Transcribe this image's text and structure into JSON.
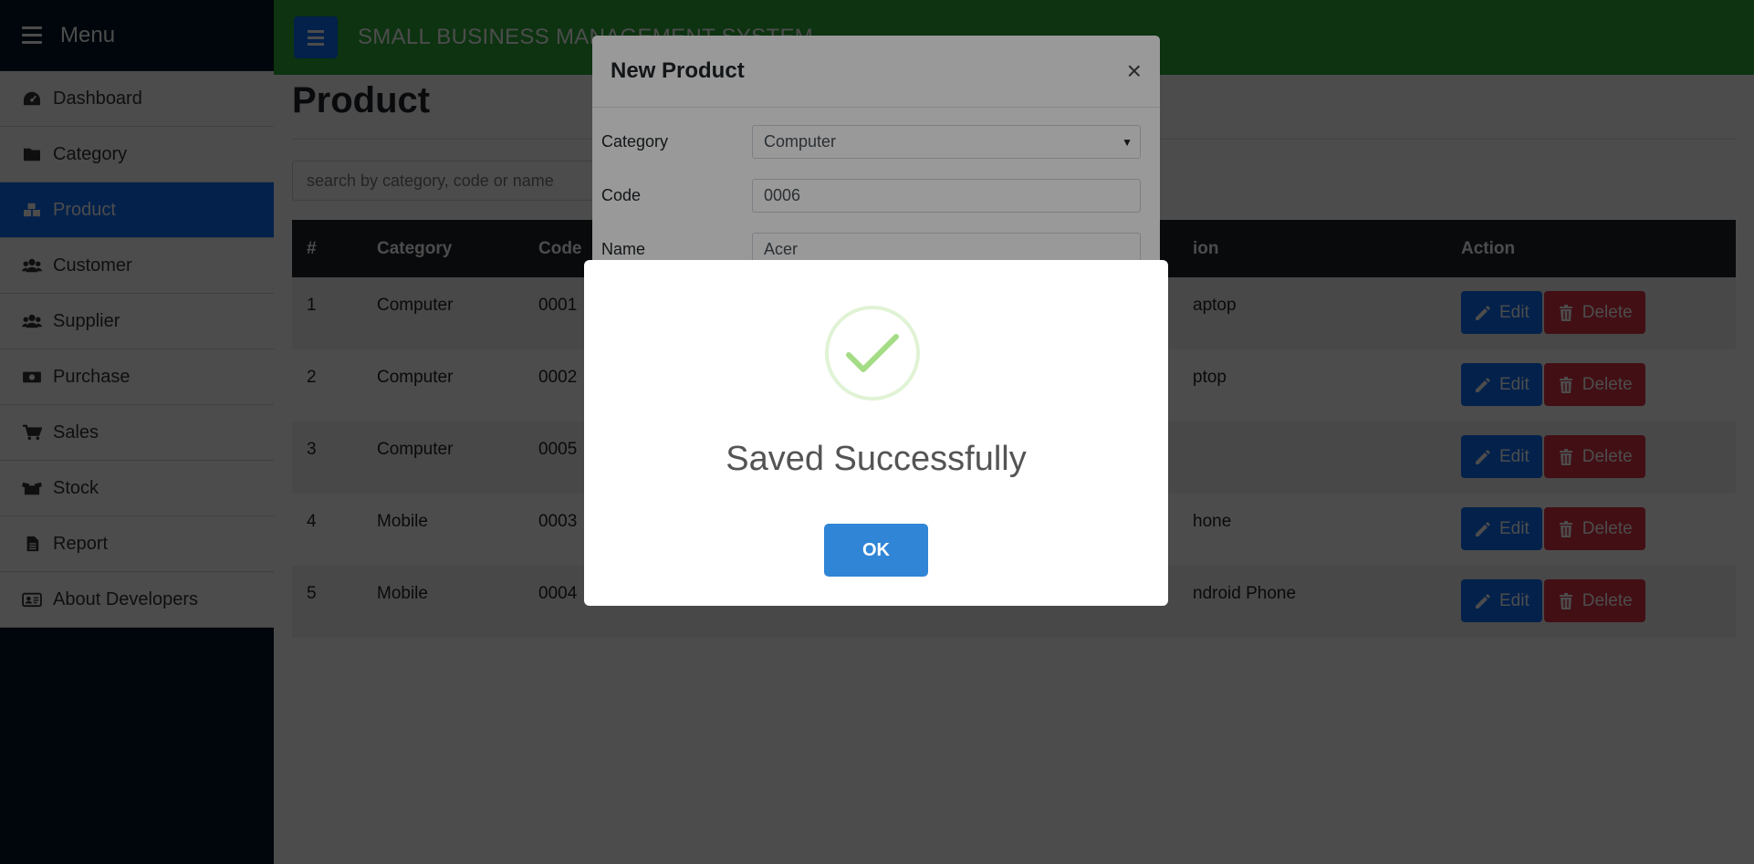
{
  "sidebar": {
    "menu_label": "Menu",
    "items": [
      {
        "label": "Dashboard",
        "icon": "dashboard-icon"
      },
      {
        "label": "Category",
        "icon": "folder-icon"
      },
      {
        "label": "Product",
        "icon": "boxes-icon",
        "active": true
      },
      {
        "label": "Customer",
        "icon": "users-icon"
      },
      {
        "label": "Supplier",
        "icon": "users-icon"
      },
      {
        "label": "Purchase",
        "icon": "money-icon"
      },
      {
        "label": "Sales",
        "icon": "cart-icon"
      },
      {
        "label": "Stock",
        "icon": "box-open-icon"
      },
      {
        "label": "Report",
        "icon": "file-icon"
      },
      {
        "label": "About Developers",
        "icon": "id-card-icon"
      }
    ]
  },
  "topbar": {
    "title": "SMALL BUSINESS MANAGEMENT SYSTEM"
  },
  "main": {
    "page_title": "Product",
    "search": {
      "placeholder": "search by category, code or name",
      "value": ""
    },
    "table": {
      "headers": {
        "num": "#",
        "category": "Category",
        "code": "Code",
        "description": "ion",
        "action": "Action"
      },
      "rows": [
        {
          "num": "1",
          "category": "Computer",
          "code": "0001",
          "description": "aptop"
        },
        {
          "num": "2",
          "category": "Computer",
          "code": "0002",
          "description": "ptop"
        },
        {
          "num": "3",
          "category": "Computer",
          "code": "0005",
          "description": ""
        },
        {
          "num": "4",
          "category": "Mobile",
          "code": "0003",
          "description": "hone"
        },
        {
          "num": "5",
          "category": "Mobile",
          "code": "0004",
          "description": "ndroid Phone"
        }
      ],
      "edit_label": "Edit",
      "delete_label": "Delete"
    }
  },
  "product_modal": {
    "title": "New Product",
    "close_glyph": "×",
    "fields": {
      "category": {
        "label": "Category",
        "value": "Computer"
      },
      "code": {
        "label": "Code",
        "value": "0006"
      },
      "name": {
        "label": "Name",
        "value": "Acer"
      }
    }
  },
  "alert": {
    "title": "Saved Successfully",
    "ok_label": "OK",
    "icon": "success-check-icon"
  },
  "colors": {
    "sidebar_bg": "#021427",
    "topbar_bg": "#2eaa3a",
    "primary": "#0d6efd",
    "danger": "#dc3545",
    "ok_button": "#3085d6",
    "success_check": "#a5dc86"
  }
}
